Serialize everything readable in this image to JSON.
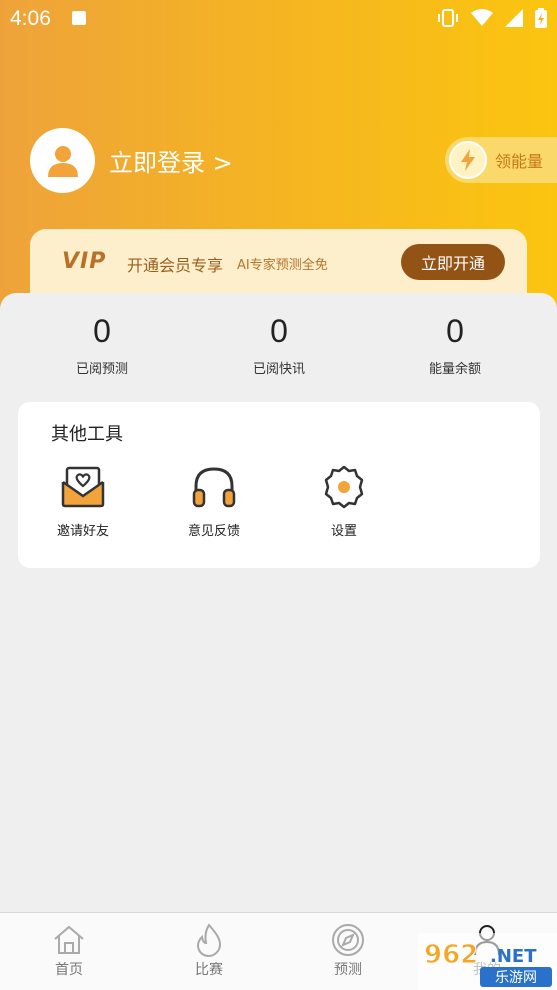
{
  "status_bar": {
    "time": "4:06"
  },
  "profile": {
    "login_label": "立即登录 >"
  },
  "energy": {
    "label": "领能量"
  },
  "vip": {
    "logo": "VIP",
    "title": "开通会员专享",
    "subtitle": "AI专家预测全免",
    "button": "立即开通"
  },
  "stats": [
    {
      "value": "0",
      "label": "已阅预测"
    },
    {
      "value": "0",
      "label": "已阅快讯"
    },
    {
      "value": "0",
      "label": "能量余额"
    }
  ],
  "tools": {
    "title": "其他工具",
    "items": [
      {
        "label": "邀请好友",
        "icon": "invite-mail-icon"
      },
      {
        "label": "意见反馈",
        "icon": "headphones-icon"
      },
      {
        "label": "设置",
        "icon": "gear-icon"
      }
    ]
  },
  "tabbar": {
    "items": [
      {
        "label": "首页",
        "icon": "home-icon"
      },
      {
        "label": "比赛",
        "icon": "flame-icon"
      },
      {
        "label": "预测",
        "icon": "compass-icon"
      },
      {
        "label": "我的",
        "icon": "profile-icon"
      }
    ]
  },
  "watermark": {
    "text": "962.NET",
    "sub": "乐游网"
  },
  "colors": {
    "header_start": "#eea33a",
    "header_end": "#fbc50f",
    "vip_button": "#935315",
    "accent_orange": "#f2a33a"
  }
}
